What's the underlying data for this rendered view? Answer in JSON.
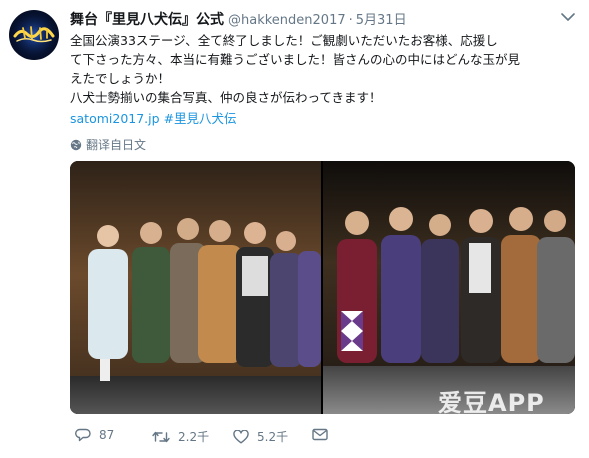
{
  "account": {
    "display_name": "舞台『里見八犬伝』公式",
    "handle": "@hakkenden2017",
    "separator": "·",
    "date": "5月31日",
    "avatar_text": "里見八犬伝"
  },
  "tweet": {
    "lines": [
      "全国公演33ステージ、全て終了しました！ご観劇いただいたお客様、応援し",
      "て下さった方々、本当に有難うございました！皆さんの心の中にはどんな玉が見",
      "えたでしょうか！",
      "八犬士勢揃いの集合写真、仲の良さが伝わってきます！"
    ],
    "link": "satomi2017.jp",
    "hashtag": "#里見八犬伝",
    "translate_label": "翻译自日文"
  },
  "actions": {
    "reply_count": "87",
    "retweet_count": "2.2千",
    "like_count": "5.2千"
  },
  "watermark": {
    "main": "爱豆APP",
    "sub": "i d o l   -   a p p"
  },
  "colors": {
    "link": "#1b95e0",
    "meta": "#657786",
    "text": "#14171a"
  },
  "icons": [
    "caret-down-icon",
    "globe-icon",
    "reply-icon",
    "retweet-icon",
    "heart-icon",
    "envelope-icon"
  ]
}
